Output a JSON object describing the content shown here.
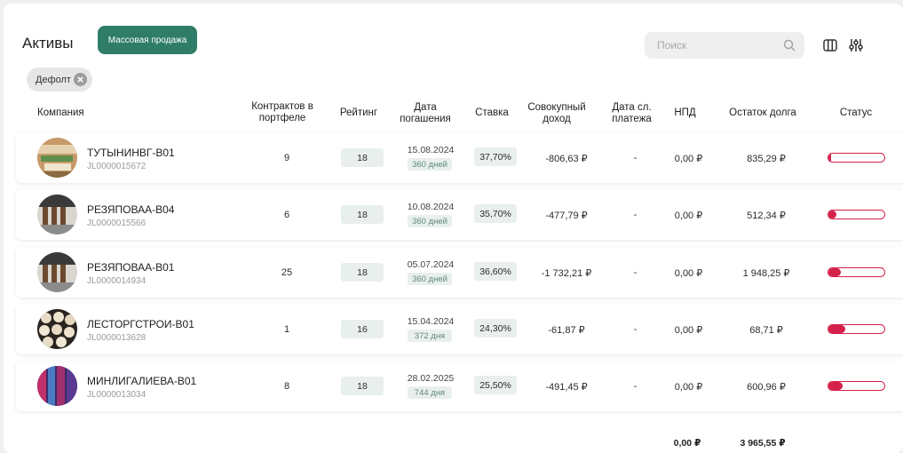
{
  "page": {
    "title": "Активы",
    "mass_sale_label": "Массовая продажа",
    "search_placeholder": "Поиск",
    "filter_chip": "Дефолт"
  },
  "icons": {
    "search": "search-icon",
    "columns": "columns-icon",
    "settings": "sliders-icon",
    "chip_remove": "close-icon"
  },
  "colors": {
    "accent": "#2f7d68",
    "status": "#d4204a",
    "badge_bg": "#e9efed"
  },
  "columns": {
    "company": "Компания",
    "contracts": "Контрактов в портфеле",
    "rating": "Рейтинг",
    "maturity": "Дата погашения",
    "rate": "Ставка",
    "income": "Совокупный доход",
    "next_payment": "Дата сл. платежа",
    "npd": "НПД",
    "debt": "Остаток долга",
    "status": "Статус"
  },
  "rows": [
    {
      "name": "ТУТЫНИНВГ-В01",
      "id": "JL0000015672",
      "contracts": "9",
      "rating": "18",
      "date": "15.08.2024",
      "days": "360 дней",
      "rate": "37,70%",
      "income": "-806,63 ₽",
      "next": "-",
      "npd": "0,00 ₽",
      "debt": "835,29 ₽",
      "status_fill": 0.05
    },
    {
      "name": "РЕЗЯПОВАА-В04",
      "id": "JL0000015566",
      "contracts": "6",
      "rating": "18",
      "date": "10.08.2024",
      "days": "360 дней",
      "rate": "35,70%",
      "income": "-477,79 ₽",
      "next": "-",
      "npd": "0,00 ₽",
      "debt": "512,34 ₽",
      "status_fill": 0.15
    },
    {
      "name": "РЕЗЯПОВАА-В01",
      "id": "JL0000014934",
      "contracts": "25",
      "rating": "18",
      "date": "05.07.2024",
      "days": "360 дней",
      "rate": "36,60%",
      "income": "-1 732,21 ₽",
      "next": "-",
      "npd": "0,00 ₽",
      "debt": "1 948,25 ₽",
      "status_fill": 0.22
    },
    {
      "name": "ЛЕСТОРГСТРОИ-В01",
      "id": "JL0000013628",
      "contracts": "1",
      "rating": "16",
      "date": "15.04.2024",
      "days": "372 дня",
      "rate": "24,30%",
      "income": "-61,87 ₽",
      "next": "-",
      "npd": "0,00 ₽",
      "debt": "68,71 ₽",
      "status_fill": 0.3
    },
    {
      "name": "МИНЛИГАЛИЕВА-В01",
      "id": "JL0000013034",
      "contracts": "8",
      "rating": "18",
      "date": "28.02.2025",
      "days": "744 дня",
      "rate": "25,50%",
      "income": "-491,45 ₽",
      "next": "-",
      "npd": "0,00 ₽",
      "debt": "600,96 ₽",
      "status_fill": 0.25
    }
  ],
  "totals": {
    "npd": "0,00 ₽",
    "debt": "3 965,55 ₽"
  }
}
